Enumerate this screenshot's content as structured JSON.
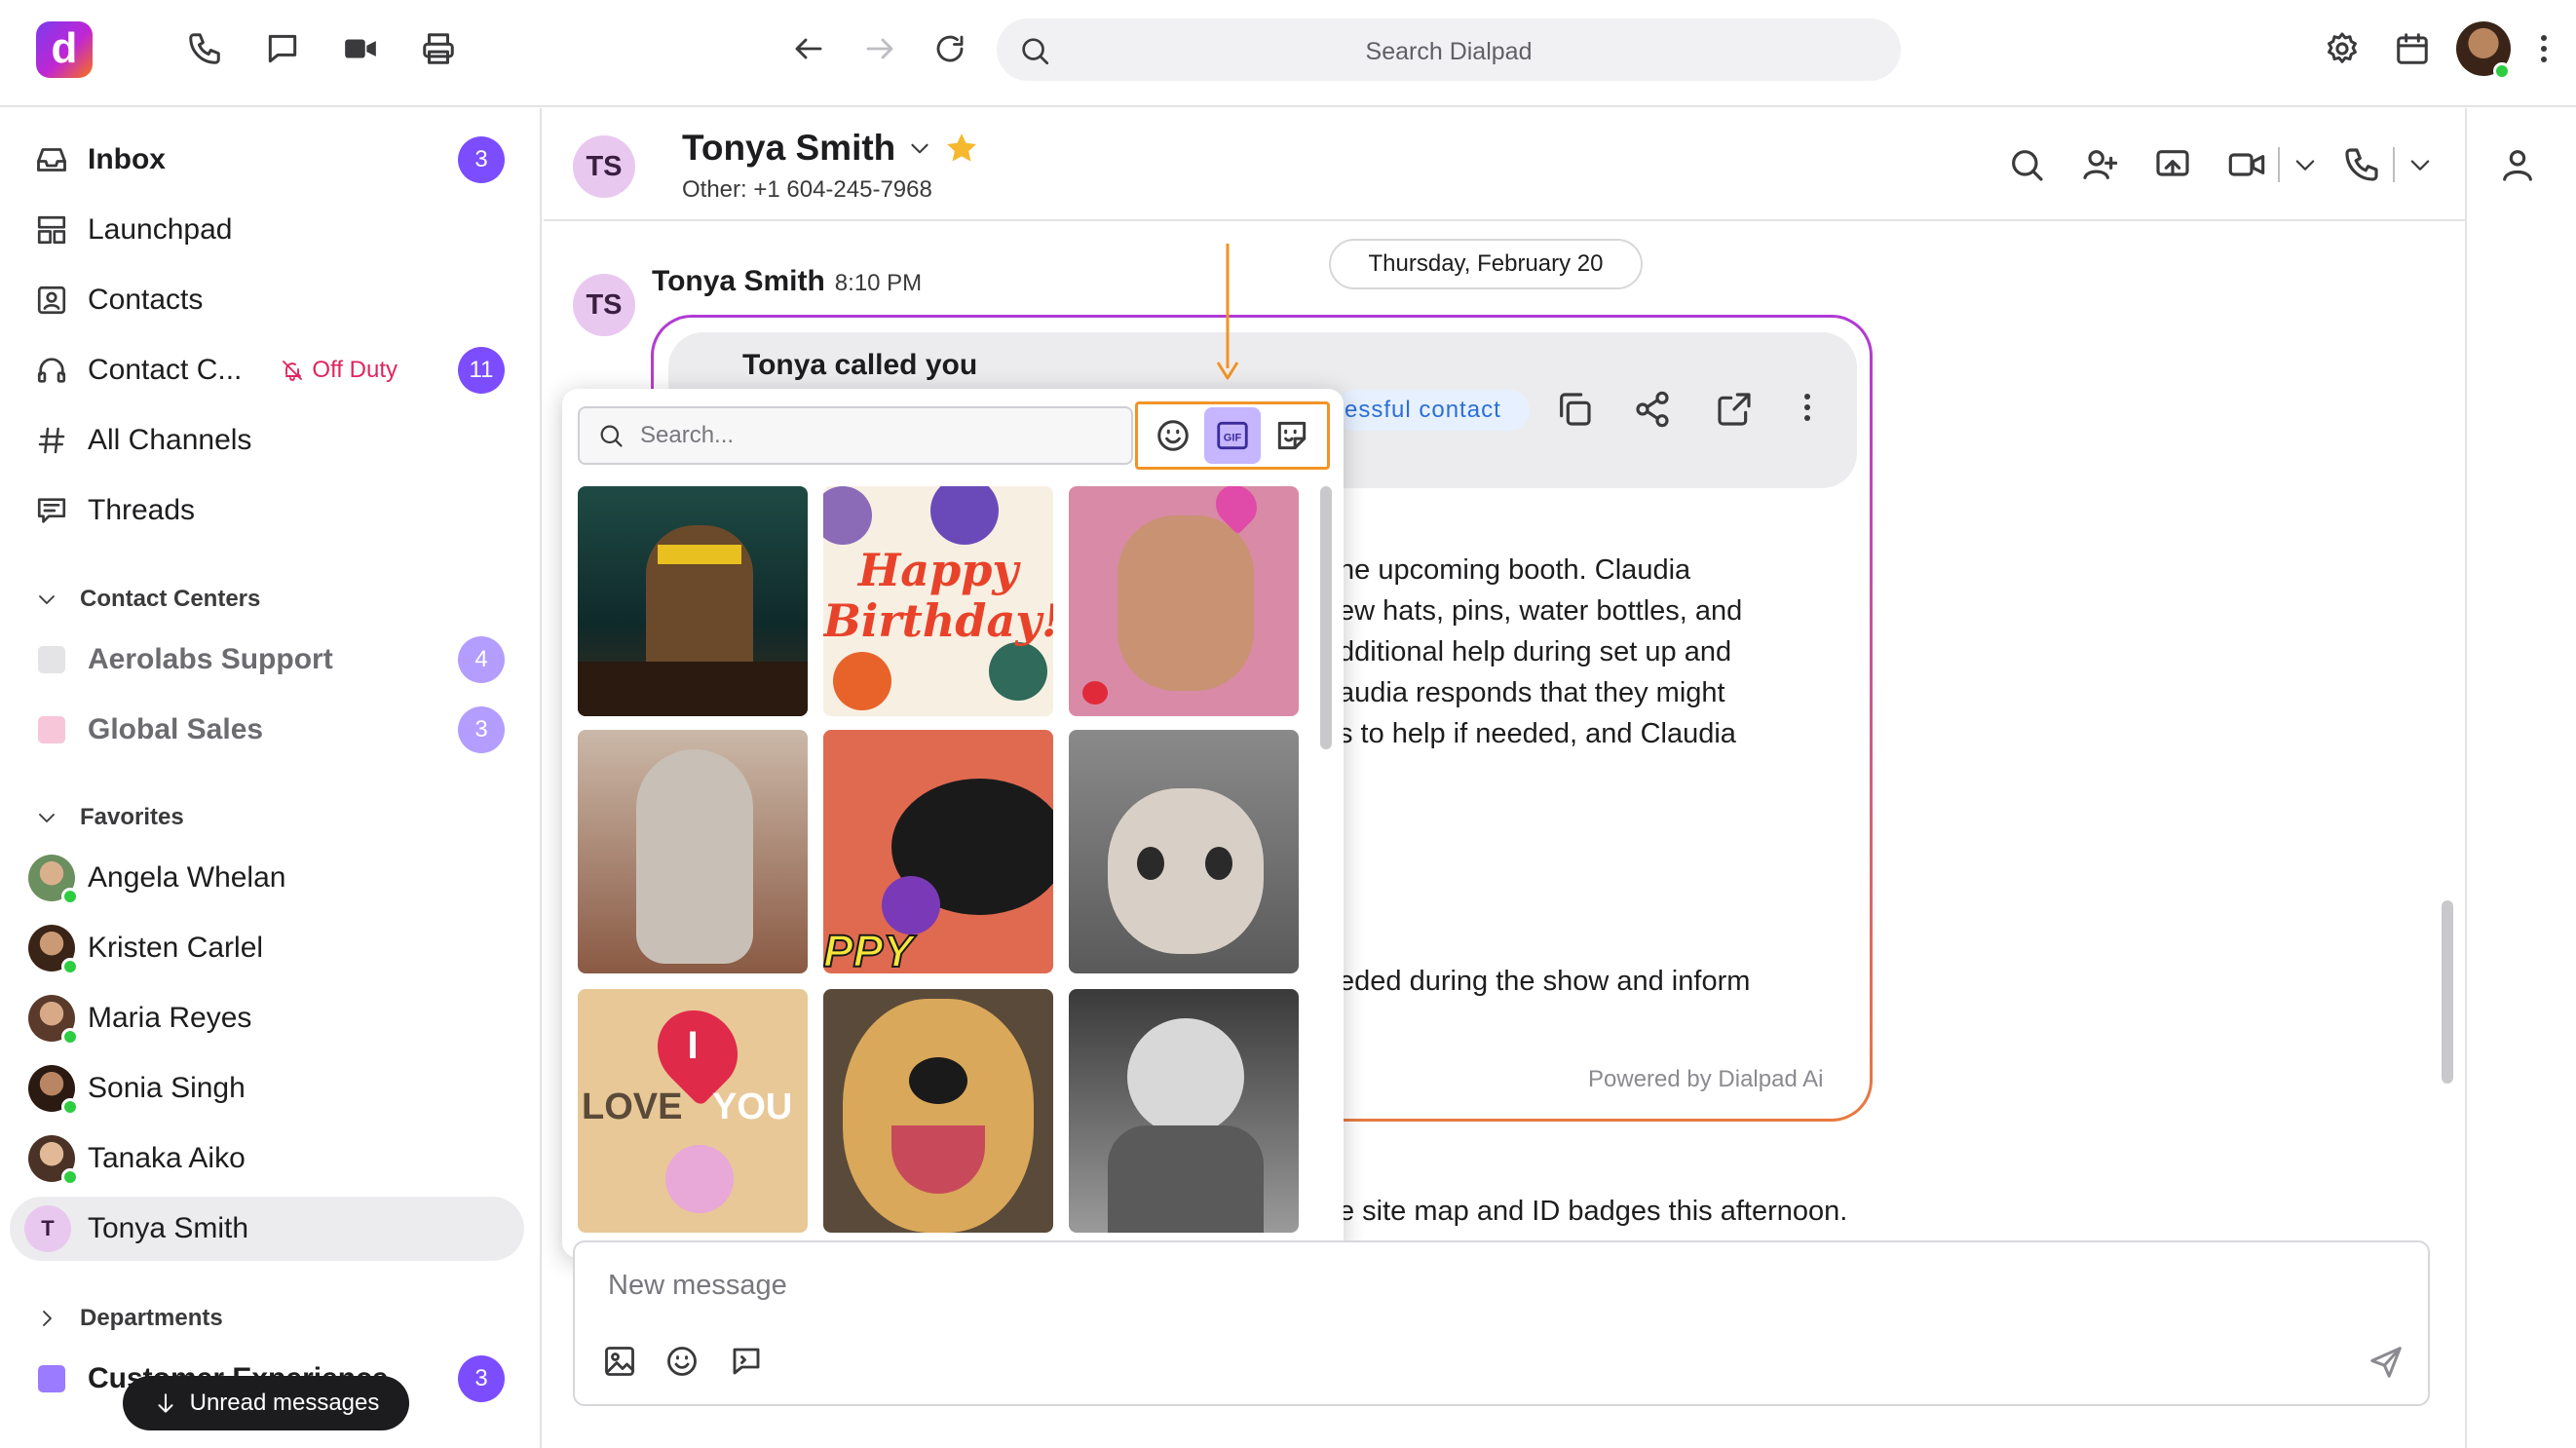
{
  "topbar": {
    "logo_letter": "d",
    "search_placeholder": "Search Dialpad",
    "icons": [
      "phone-icon",
      "chat-icon",
      "video-icon",
      "printer-icon",
      "back-arrow-icon",
      "forward-arrow-icon",
      "refresh-icon",
      "search-icon",
      "settings-icon",
      "calendar-icon",
      "user-avatar",
      "more-icon"
    ]
  },
  "sidebar": {
    "nav": [
      {
        "label": "Inbox",
        "badge": "3",
        "icon": "inbox-icon"
      },
      {
        "label": "Launchpad",
        "icon": "launchpad-icon"
      },
      {
        "label": "Contacts",
        "icon": "contacts-icon"
      },
      {
        "label": "Contact C...",
        "status": "Off Duty",
        "badge": "11",
        "icon": "headset-icon"
      },
      {
        "label": "All Channels",
        "icon": "hash-icon"
      },
      {
        "label": "Threads",
        "icon": "threads-icon"
      }
    ],
    "contact_centers": {
      "title": "Contact Centers",
      "items": [
        {
          "label": "Aerolabs Support",
          "badge": "4",
          "color": "#e4e4e7"
        },
        {
          "label": "Global Sales",
          "badge": "3",
          "color": "#f7c6d8"
        }
      ]
    },
    "favorites": {
      "title": "Favorites",
      "items": [
        {
          "label": "Angela Whelan"
        },
        {
          "label": "Kristen Carlel"
        },
        {
          "label": "Maria Reyes"
        },
        {
          "label": "Sonia Singh"
        },
        {
          "label": "Tanaka Aiko"
        },
        {
          "label": "Tonya Smith",
          "initial": "T"
        }
      ]
    },
    "departments": {
      "title": "Departments",
      "items": [
        {
          "label": "Customer Experience",
          "badge": "3",
          "color": "#9b7bff"
        }
      ]
    },
    "toast": "Unread messages"
  },
  "chat": {
    "contact_initials": "TS",
    "contact_name": "Tonya Smith",
    "contact_sub": "Other: +1 604-245-7968",
    "date_divider": "Thursday, February 20",
    "message_sender": "Tonya Smith",
    "message_time": "8:10 PM",
    "called_title": "Tonya called you",
    "disposition_chip": "essful contact",
    "summary_lines": [
      "he upcoming booth. Claudia",
      "ew hats, pins, water bottles, and",
      "dditional help during set up and",
      "audia responds that they might",
      "s to help if needed, and Claudia"
    ],
    "summary_line_2": "eded during the show and inform",
    "powered_by": "Powered by Dialpad Ai",
    "last_message": "e site map and ID badges this afternoon.",
    "composer_placeholder": "New message"
  },
  "gif_picker": {
    "search_placeholder": "Search...",
    "tabs": [
      "emoji-tab",
      "gif-tab",
      "sticker-tab"
    ],
    "active_tab": "gif-tab",
    "gif_texts": {
      "birthday": "Happy Birthday!",
      "love_1": "LOVE",
      "love_2": "YOU",
      "love_i": "I",
      "ppy": "PPY"
    }
  },
  "colors": {
    "accent": "#7c4dff",
    "highlight": "#f29326",
    "off_duty": "#e0245e"
  }
}
